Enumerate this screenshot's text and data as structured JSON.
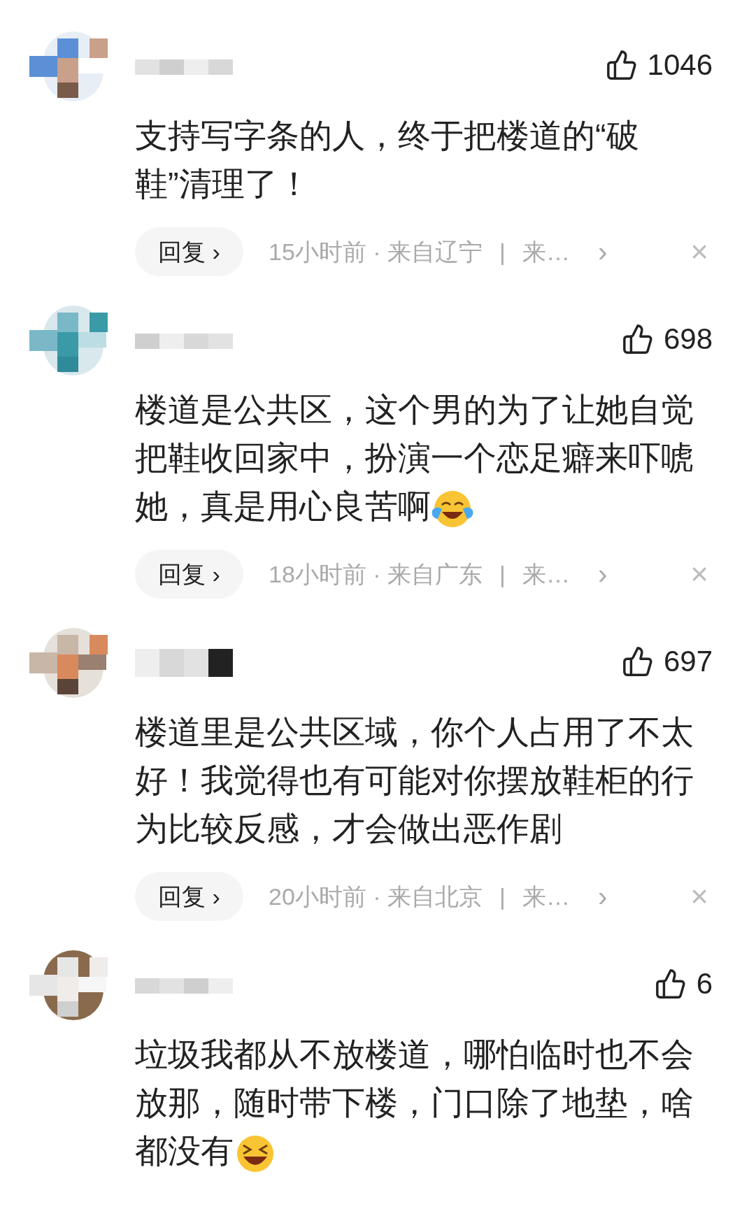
{
  "comments": [
    {
      "likes": "1046",
      "text": "支持写字条的人，终于把楼道的“破鞋”清理了！",
      "reply": {
        "label": "回复 ›",
        "time": "15小时前 · 来自辽宁",
        "separator": "|",
        "source": "来…",
        "chevron": "›",
        "close": "×"
      }
    },
    {
      "likes": "698",
      "text": "楼道是公共区，这个男的为了让她自觉把鞋收回家中，扮演一个恋足癖来吓唬她，真是用心良苦啊",
      "emoji": {
        "kind": "tears"
      },
      "reply": {
        "label": "回复 ›",
        "time": "18小时前 · 来自广东",
        "separator": "|",
        "source": "来…",
        "chevron": "›",
        "close": "×"
      }
    },
    {
      "likes": "697",
      "text": "楼道里是公共区域，你个人占用了不太好！我觉得也有可能对你摆放鞋柜的行为比较反感，才会做出恶作剧",
      "reply": {
        "label": "回复 ›",
        "time": "20小时前 · 来自北京",
        "separator": "|",
        "source": "来…",
        "chevron": "›",
        "close": "×"
      }
    },
    {
      "likes": "6",
      "text": "垃圾我都从不放楼道，哪怕临时也不会放那，随时带下楼，门口除了地垫，啥都没有",
      "emoji": {
        "kind": "grin"
      }
    }
  ]
}
